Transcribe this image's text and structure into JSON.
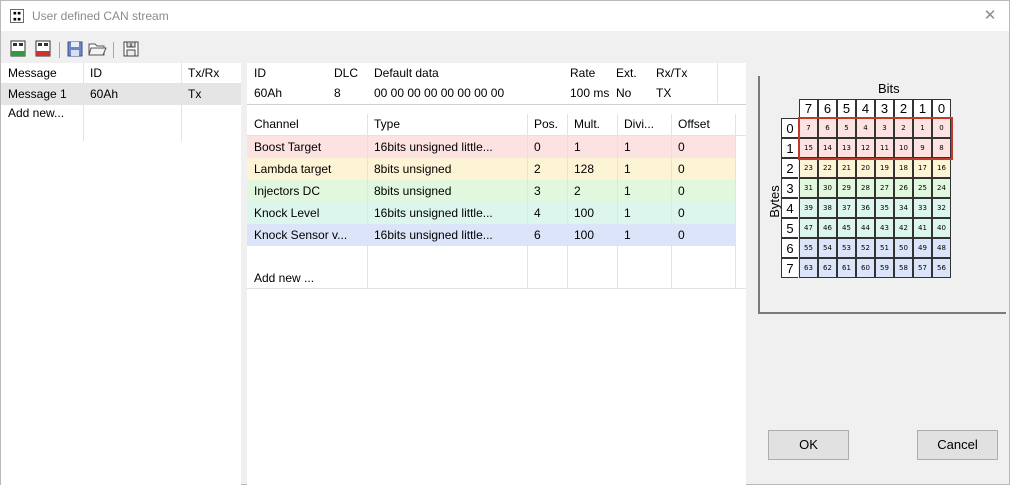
{
  "window": {
    "title": "User defined CAN stream"
  },
  "toolbar": {
    "buttons": [
      "add-message-icon",
      "remove-message-icon",
      "save-icon",
      "open-folder-icon",
      "export-icon"
    ]
  },
  "messages": {
    "headers": [
      "Message",
      "ID",
      "Tx/Rx"
    ],
    "rows": [
      {
        "message": "Message 1",
        "id": "60Ah",
        "txrx": "Tx"
      }
    ],
    "add_new": "Add new..."
  },
  "msg_detail": {
    "headers": [
      "ID",
      "DLC",
      "Default data",
      "Rate",
      "Ext.",
      "Rx/Tx"
    ],
    "row": {
      "id": "60Ah",
      "dlc": "8",
      "default_data": "00 00 00 00 00 00 00 00",
      "rate": "100 ms",
      "ext": "No",
      "rxtx": "TX"
    }
  },
  "channels": {
    "headers": [
      "Channel",
      "Type",
      "Pos.",
      "Mult.",
      "Divi...",
      "Offset"
    ],
    "rows": [
      {
        "channel": "Boost Target",
        "type": "16bits unsigned little...",
        "pos": "0",
        "mult": "1",
        "div": "1",
        "offset": "0",
        "color": "#fde2e2"
      },
      {
        "channel": "Lambda target",
        "type": "8bits unsigned",
        "pos": "2",
        "mult": "128",
        "div": "1",
        "offset": "0",
        "color": "#fdf4d6"
      },
      {
        "channel": "Injectors DC",
        "type": "8bits unsigned",
        "pos": "3",
        "mult": "2",
        "div": "1",
        "offset": "0",
        "color": "#e2f8de"
      },
      {
        "channel": "Knock Level",
        "type": "16bits unsigned little...",
        "pos": "4",
        "mult": "100",
        "div": "1",
        "offset": "0",
        "color": "#dcf6ee"
      },
      {
        "channel": "Knock Sensor v...",
        "type": "16bits unsigned little...",
        "pos": "6",
        "mult": "100",
        "div": "1",
        "offset": "0",
        "color": "#dbe4f8"
      }
    ],
    "add_new": "Add new ..."
  },
  "bits_panel": {
    "bits_label": "Bits",
    "bytes_label": "Bytes",
    "col_labels": [
      "7",
      "6",
      "5",
      "4",
      "3",
      "2",
      "1",
      "0"
    ],
    "row_labels": [
      "0",
      "1",
      "2",
      "3",
      "4",
      "5",
      "6",
      "7"
    ],
    "row_colors": [
      "#fde2e2",
      "#fde2e2",
      "#fdf4d6",
      "#e2f8de",
      "#dcf6ee",
      "#dcf6ee",
      "#dbe4f8",
      "#dbe4f8"
    ],
    "selected_rows": [
      0,
      1
    ]
  },
  "buttons": {
    "ok": "OK",
    "cancel": "Cancel"
  }
}
